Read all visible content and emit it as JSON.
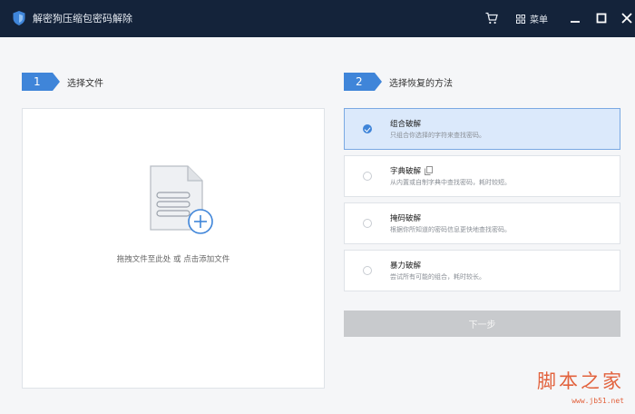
{
  "window": {
    "title": "解密狗压缩包密码解除",
    "menu_label": "菜单"
  },
  "step1": {
    "number": "1",
    "label": "选择文件",
    "drop_hint": "拖拽文件至此处 或 点击添加文件"
  },
  "step2": {
    "number": "2",
    "label": "选择恢复的方法",
    "methods": [
      {
        "name": "组合破解",
        "desc": "只组合你选择的字符来查找密码。",
        "selected": true
      },
      {
        "name": "字典破解",
        "desc": "从内置或自制字典中查找密码，耗时较短。",
        "selected": false
      },
      {
        "name": "掩码破解",
        "desc": "根据你所知道的密码信息更快地查找密码。",
        "selected": false
      },
      {
        "name": "暴力破解",
        "desc": "尝试所有可能的组合，耗时较长。",
        "selected": false
      }
    ],
    "next_label": "下一步"
  },
  "watermark": {
    "brand": "脚本之家",
    "url": "www.jb51.net"
  },
  "colors": {
    "titlebar": "#14233a",
    "accent": "#3f85d9",
    "selected_bg": "#dbe9fb",
    "disabled_button": "#c8cacd",
    "watermark": "#e2623d"
  }
}
